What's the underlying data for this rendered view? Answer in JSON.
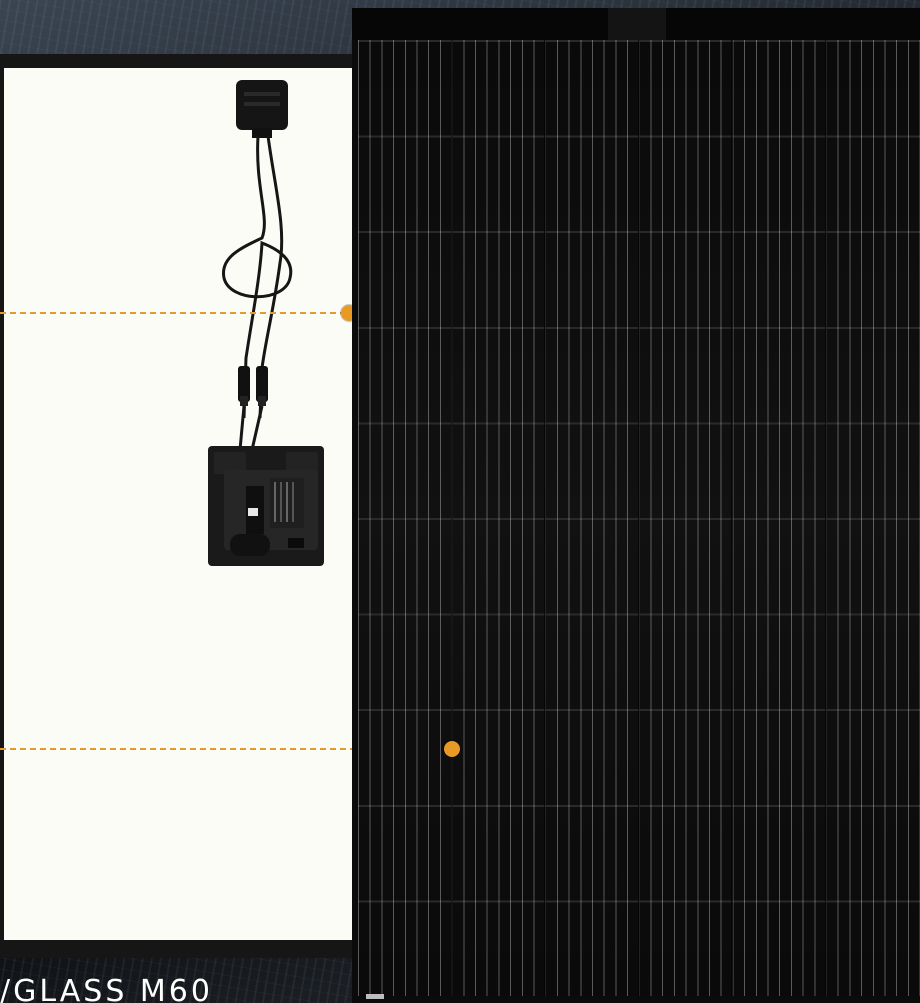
{
  "caption": {
    "text": "/GLASS M60"
  },
  "colors": {
    "callout_accent": "#e99a24",
    "panel_black": "#0b0b0b",
    "sheet_white": "#fcfcf6"
  },
  "icons": {
    "microinverter": "microinverter-icon",
    "connector": "junction-box-icon",
    "callout": "callout-dot-icon"
  }
}
